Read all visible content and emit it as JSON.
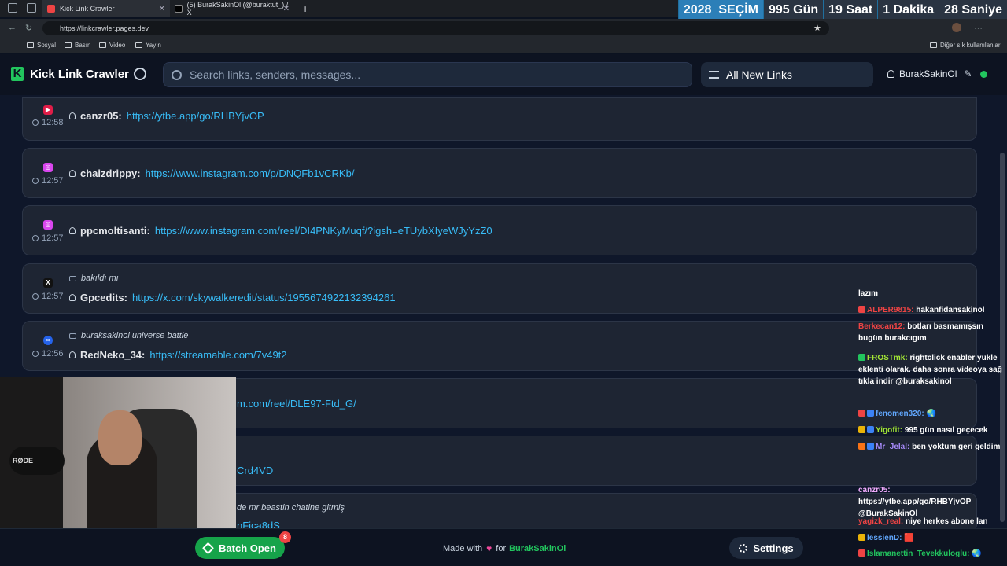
{
  "browser": {
    "tabs": [
      {
        "label": "Kick Link Crawler",
        "active": true
      },
      {
        "label": "(5) BurakSakinOl (@buraktut_) / X",
        "active": false
      }
    ],
    "new_tab": "+",
    "url": "https://linkcrawler.pages.dev",
    "bookmarks": [
      "Sosyal",
      "Basın",
      "Video",
      "Yayın"
    ],
    "other_bookmarks": "Diğer sık kullanılanlar"
  },
  "countdown": {
    "year": "2028",
    "label": "SEÇİM",
    "days": "995",
    "days_unit": "Gün",
    "hours": "19",
    "hours_unit": "Saat",
    "minutes": "1",
    "minutes_unit": "Dakika",
    "seconds": "28",
    "seconds_unit": "Saniye"
  },
  "header": {
    "logo_letter": "K",
    "app_name": "Kick Link Crawler",
    "search_placeholder": "Search links, senders, messages...",
    "filter_label": "All New Links",
    "username": "BurakSakinOl",
    "edit_icon": "✎"
  },
  "feed": [
    {
      "platform": "youtube",
      "color": "#e11d48",
      "time": "12:58",
      "sender": "canzr05:",
      "link": "https://ytbe.app/go/RHBYjvOP",
      "message": ""
    },
    {
      "platform": "instagram",
      "color": "#d946ef",
      "time": "12:57",
      "sender": "chaizdrippy:",
      "link": "https://www.instagram.com/p/DNQFb1vCRKb/",
      "message": ""
    },
    {
      "platform": "instagram",
      "color": "#d946ef",
      "time": "12:57",
      "sender": "ppcmoltisanti:",
      "link": "https://www.instagram.com/reel/DI4PNKyMuqf/?igsh=eTUybXIyeWJyYzZ0",
      "message": ""
    },
    {
      "platform": "x",
      "color": "#111111",
      "time": "12:57",
      "sender": "Gpcedits:",
      "link": "https://x.com/skywalkeredit/status/1955674922132394261",
      "message": "bakıldı mı"
    },
    {
      "platform": "streamable",
      "color": "#2563eb",
      "time": "12:56",
      "sender": "RedNeko_34:",
      "link": "https://streamable.com/7v49t2",
      "message": "buraksakinol universe battle"
    },
    {
      "platform": "instagram",
      "color": "#d946ef",
      "time": "",
      "sender": "",
      "link": "m.com/reel/DLE97-Ftd_G/",
      "message": ""
    },
    {
      "platform": "",
      "color": "",
      "time": "",
      "sender": "",
      "link": "Crd4VD",
      "message": ""
    },
    {
      "platform": "",
      "color": "",
      "time": "",
      "sender": "",
      "link": "nFica8dS",
      "message": "de mr beastin chatine gitmiş"
    }
  ],
  "chat": [
    {
      "name": "",
      "name_color": "#ffffff",
      "text": "lazım"
    },
    {
      "name": "ALPER9815:",
      "name_color": "#ef4444",
      "text": "hakanfidansakinol"
    },
    {
      "name": "Berkecan12:",
      "name_color": "#ef4444",
      "text": "botları basmamışsın bugün burakcıgım"
    },
    {
      "name": "FROSTmk:",
      "name_color": "#a3e635",
      "text": "rightclick enabler yükle eklenti olarak. daha sonra videoya sağ tıkla indir @buraksakinol"
    },
    {
      "name": "fenomen320:",
      "name_color": "#60a5fa",
      "text": "🌏"
    },
    {
      "name": "Yigofit:",
      "name_color": "#a3e635",
      "text": "995 gün nasıl geçecek"
    },
    {
      "name": "Mr_Jelal:",
      "name_color": "#a78bfa",
      "text": "ben yoktum geri geldim"
    },
    {
      "name": "canzr05:",
      "name_color": "#f0abfc",
      "text": "https://ytbe.app/go/RHBYjvOP @BurakSakinOl"
    },
    {
      "name": "yagizk_real:",
      "name_color": "#ef4444",
      "text": "niye herkes abone lan"
    },
    {
      "name": "lessienD:",
      "name_color": "#60a5fa",
      "text": "🟥"
    },
    {
      "name": "Islamanettin_Tevekkuloglu:",
      "name_color": "#22c55e",
      "text": "🌏"
    }
  ],
  "footer": {
    "batch_label": "Batch Open",
    "batch_count": "8",
    "made_with": "Made with",
    "heart": "♥",
    "made_for": "for",
    "made_by": "BurakSakinOl",
    "settings_label": "Settings"
  },
  "webcam": {
    "mic_brand": "RØDE"
  }
}
